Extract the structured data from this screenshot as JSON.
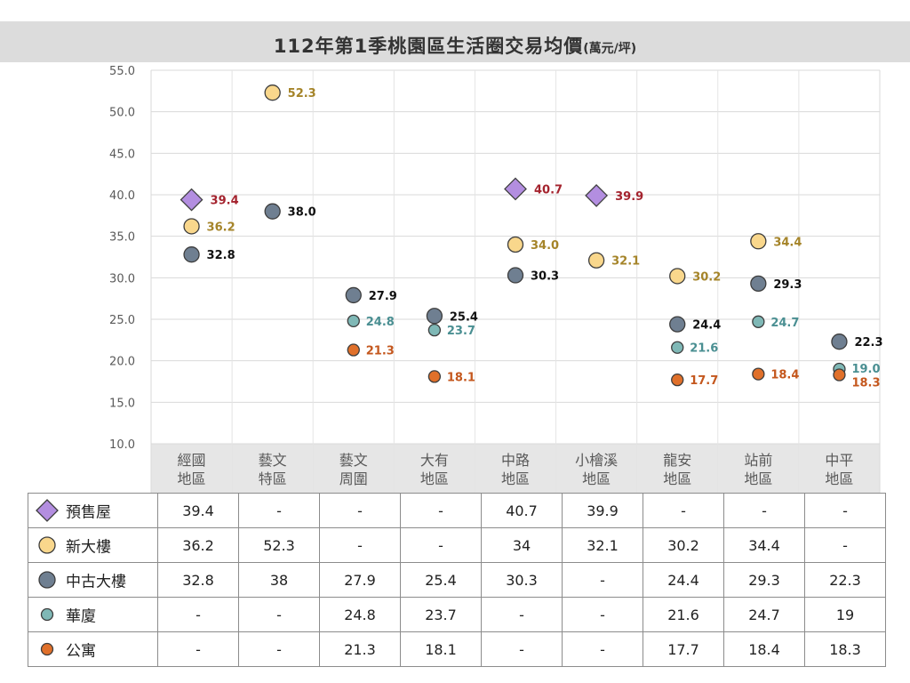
{
  "title": "112年第1季桃園區生活圈交易均價",
  "title_unit": "(萬元/坪)",
  "colors": {
    "presale": "#b38ee0",
    "new": "#f9d78c",
    "used": "#6f7f91",
    "huaxia": "#7fb8b6",
    "apartment": "#e0702a",
    "presale_label": "#a4232e",
    "new_label": "#a58429",
    "used_label": "#111111",
    "huaxia_label": "#4a8f92",
    "apartment_label": "#c4571d"
  },
  "chart_data": {
    "type": "scatter",
    "ylim": [
      10,
      55
    ],
    "yticks": [
      "10.0",
      "15.0",
      "20.0",
      "25.0",
      "30.0",
      "35.0",
      "40.0",
      "45.0",
      "50.0",
      "55.0"
    ],
    "grid": true,
    "categories": [
      "經國\n地區",
      "藝文\n特區",
      "藝文\n周圍",
      "大有\n地區",
      "中路\n地區",
      "小檜溪\n地區",
      "龍安\n地區",
      "站前\n地區",
      "中平\n地區"
    ],
    "series": [
      {
        "key": "presale",
        "name": "預售屋",
        "marker": "diamond",
        "values": [
          39.4,
          null,
          null,
          null,
          40.7,
          39.9,
          null,
          null,
          null
        ]
      },
      {
        "key": "new",
        "name": "新大樓",
        "marker": "circle-large",
        "values": [
          36.2,
          52.3,
          null,
          null,
          34.0,
          32.1,
          30.2,
          34.4,
          null
        ]
      },
      {
        "key": "used",
        "name": "中古大樓",
        "marker": "circle-large",
        "values": [
          32.8,
          38.0,
          27.9,
          25.4,
          30.3,
          null,
          24.4,
          29.3,
          22.3
        ]
      },
      {
        "key": "huaxia",
        "name": "華廈",
        "marker": "circle-small",
        "values": [
          null,
          null,
          24.8,
          23.7,
          null,
          null,
          21.6,
          24.7,
          19.0
        ]
      },
      {
        "key": "apartment",
        "name": "公寓",
        "marker": "circle-small",
        "values": [
          null,
          null,
          21.3,
          18.1,
          null,
          null,
          17.7,
          18.4,
          18.3
        ]
      }
    ]
  },
  "table": {
    "rows": [
      {
        "key": "presale",
        "label": "預售屋",
        "cells": [
          "39.4",
          "-",
          "-",
          "-",
          "40.7",
          "39.9",
          "-",
          "-",
          "-"
        ]
      },
      {
        "key": "new",
        "label": "新大樓",
        "cells": [
          "36.2",
          "52.3",
          "-",
          "-",
          "34",
          "32.1",
          "30.2",
          "34.4",
          "-"
        ]
      },
      {
        "key": "used",
        "label": "中古大樓",
        "cells": [
          "32.8",
          "38",
          "27.9",
          "25.4",
          "30.3",
          "-",
          "24.4",
          "29.3",
          "22.3"
        ]
      },
      {
        "key": "huaxia",
        "label": "華廈",
        "cells": [
          "-",
          "-",
          "24.8",
          "23.7",
          "-",
          "-",
          "21.6",
          "24.7",
          "19"
        ]
      },
      {
        "key": "apartment",
        "label": "公寓",
        "cells": [
          "-",
          "-",
          "21.3",
          "18.1",
          "-",
          "-",
          "17.7",
          "18.4",
          "18.3"
        ]
      }
    ]
  }
}
